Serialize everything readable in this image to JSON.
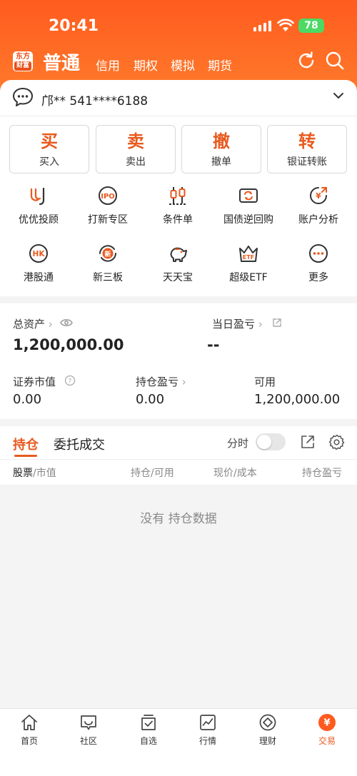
{
  "status_bar": {
    "time": "20:41",
    "battery": "78"
  },
  "header": {
    "logo_top": "东方",
    "logo_bottom": "财富",
    "title": "普通",
    "tabs": [
      "信用",
      "期权",
      "模拟",
      "期货"
    ]
  },
  "account": {
    "label": "邝** 541****6188"
  },
  "actions": [
    {
      "big": "买",
      "small": "买入"
    },
    {
      "big": "卖",
      "small": "卖出"
    },
    {
      "big": "撤",
      "small": "撤单"
    },
    {
      "big": "转",
      "small": "银证转账"
    }
  ],
  "grid": [
    {
      "label": "优优投顾",
      "icon": "uu-icon"
    },
    {
      "label": "打新专区",
      "icon": "ipo-icon"
    },
    {
      "label": "条件单",
      "icon": "candlestick-icon"
    },
    {
      "label": "国债逆回购",
      "icon": "bond-icon"
    },
    {
      "label": "账户分析",
      "icon": "analysis-icon"
    },
    {
      "label": "港股通",
      "icon": "hk-icon"
    },
    {
      "label": "新三板",
      "icon": "new-board-icon"
    },
    {
      "label": "天天宝",
      "icon": "piggy-icon"
    },
    {
      "label": "超级ETF",
      "icon": "etf-icon"
    },
    {
      "label": "更多",
      "icon": "more-icon"
    }
  ],
  "assets": {
    "total_label": "总资产",
    "total_value": "1,200,000.00",
    "daily_pl_label": "当日盈亏",
    "daily_pl_value": "--",
    "market_value_label": "证券市值",
    "market_value": "0.00",
    "position_pl_label": "持仓盈亏",
    "position_pl_value": "0.00",
    "available_label": "可用",
    "available_value": "1,200,000.00"
  },
  "holdings": {
    "tab_positions": "持仓",
    "tab_orders": "委托成交",
    "fenshi_label": "分时",
    "fenshi_on": false,
    "columns": [
      {
        "main": "股票",
        "sub": "/市值"
      },
      {
        "main": "持仓",
        "sub": "/可用"
      },
      {
        "main": "现价",
        "sub": "/成本"
      },
      {
        "main": "持仓盈亏",
        "sub": ""
      }
    ],
    "empty_text": "没有 持仓数据"
  },
  "bottom_nav": [
    {
      "label": "首页",
      "icon": "home-icon"
    },
    {
      "label": "社区",
      "icon": "community-icon"
    },
    {
      "label": "自选",
      "icon": "watchlist-icon"
    },
    {
      "label": "行情",
      "icon": "market-icon"
    },
    {
      "label": "理财",
      "icon": "wealth-icon"
    },
    {
      "label": "交易",
      "icon": "trade-icon",
      "active": true
    }
  ],
  "colors": {
    "brand": "#ff5b1f",
    "accent": "#e85a1e",
    "battery": "#4cd964"
  }
}
